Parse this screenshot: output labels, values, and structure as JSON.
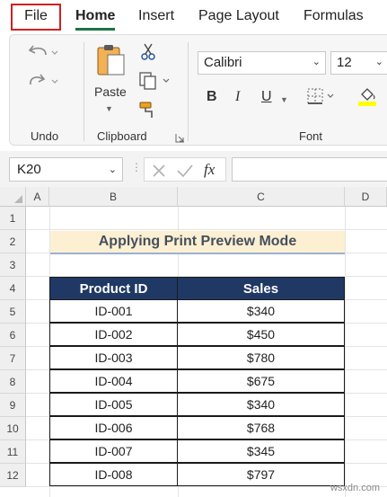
{
  "menu": {
    "tabs": [
      {
        "label": "File"
      },
      {
        "label": "Home"
      },
      {
        "label": "Insert"
      },
      {
        "label": "Page Layout"
      },
      {
        "label": "Formulas"
      }
    ],
    "active_tab": "Home",
    "highlighted_tab": "File",
    "accent_color": "#1e7145",
    "highlight_color": "#d02020"
  },
  "ribbon": {
    "undo_group_label": "Undo",
    "clipboard": {
      "paste_label": "Paste",
      "group_label": "Clipboard"
    },
    "font": {
      "font_name": "Calibri",
      "font_size": "12",
      "group_label": "Font",
      "bold": "B",
      "italic": "I",
      "underline": "U"
    }
  },
  "formula_bar": {
    "name_box": "K20",
    "fx_label": "fx",
    "formula": ""
  },
  "grid": {
    "columns": [
      "A",
      "B",
      "C",
      "D"
    ],
    "rows": [
      "1",
      "2",
      "3",
      "4",
      "5",
      "6",
      "7",
      "8",
      "9",
      "10",
      "11",
      "12"
    ],
    "title": "Applying Print Preview Mode",
    "table": {
      "headers": [
        "Product ID",
        "Sales"
      ],
      "rows": [
        [
          "ID-001",
          "$340"
        ],
        [
          "ID-002",
          "$450"
        ],
        [
          "ID-003",
          "$780"
        ],
        [
          "ID-004",
          "$675"
        ],
        [
          "ID-005",
          "$340"
        ],
        [
          "ID-006",
          "$768"
        ],
        [
          "ID-007",
          "$345"
        ],
        [
          "ID-008",
          "$797"
        ]
      ],
      "header_color": "#203864",
      "title_fill": "#fdf0d2"
    }
  },
  "watermark": "wsxdn.com"
}
